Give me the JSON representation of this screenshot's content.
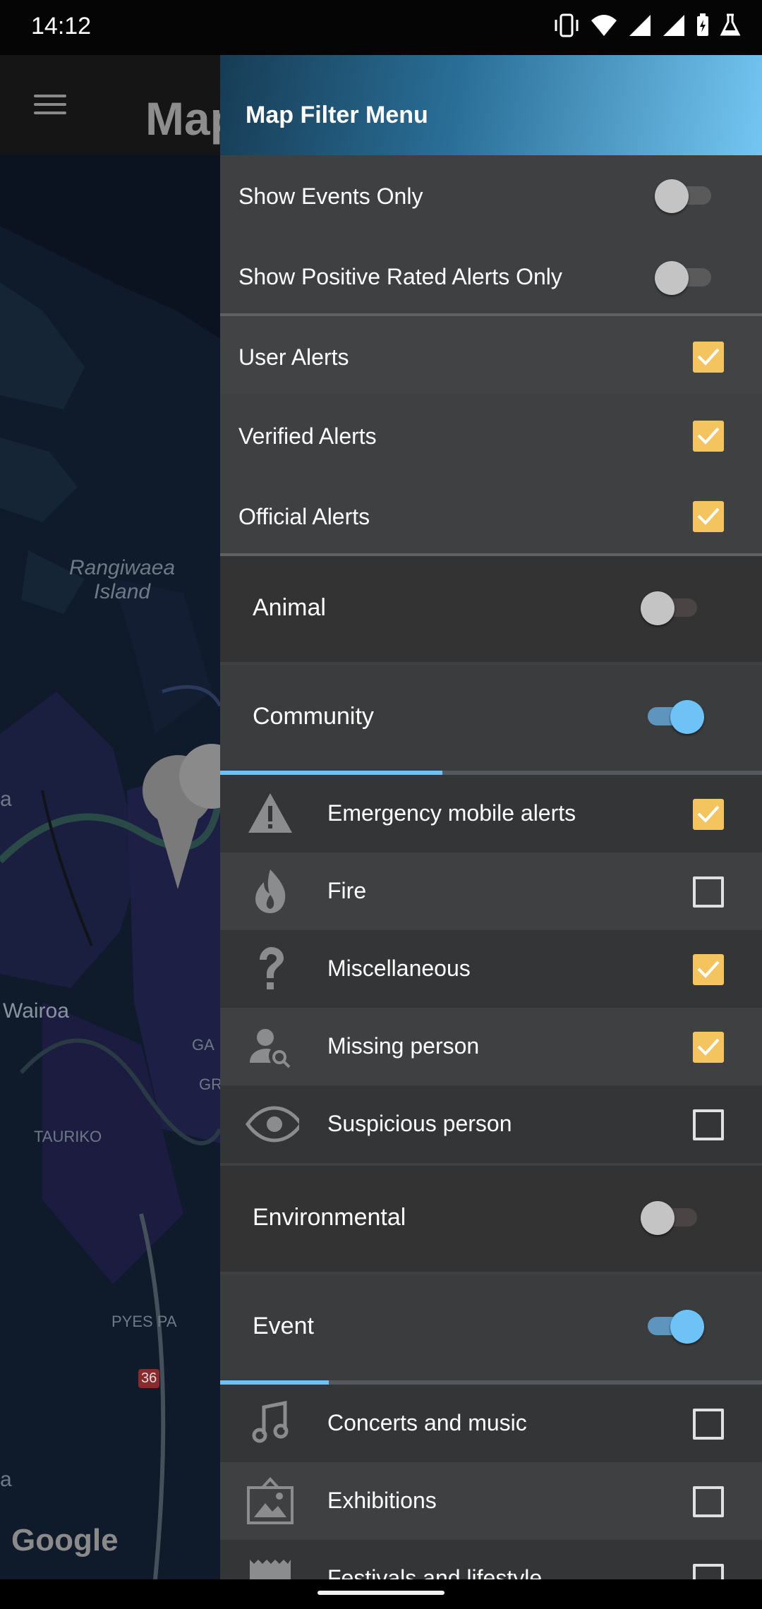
{
  "status_bar": {
    "time": "14:12"
  },
  "background_app": {
    "title": "Map",
    "map_labels": {
      "island": "Rangiwaea\nIsland",
      "wairoa": "Wairoa",
      "tauriko": "TAURIKO",
      "pyes_pa": "PYES PA",
      "route": "36",
      "edge_a1": "a",
      "edge_a2": "a",
      "ga": "GA",
      "gr": "GR"
    },
    "google_logo": "Google"
  },
  "drawer": {
    "title": "Map Filter Menu",
    "toggles": [
      {
        "label": "Show Events Only",
        "on": false
      },
      {
        "label": "Show Positive Rated Alerts Only",
        "on": false
      }
    ],
    "alert_types": [
      {
        "label": "User Alerts",
        "checked": true
      },
      {
        "label": "Verified Alerts",
        "checked": true
      },
      {
        "label": "Official Alerts",
        "checked": true
      }
    ],
    "categories": {
      "animal": {
        "label": "Animal",
        "on": false
      },
      "community": {
        "label": "Community",
        "on": true,
        "tab_progress": 0.41,
        "items": [
          {
            "label": "Emergency mobile alerts",
            "icon": "warning-icon",
            "checked": true
          },
          {
            "label": "Fire",
            "icon": "fire-icon",
            "checked": false
          },
          {
            "label": "Miscellaneous",
            "icon": "question-icon",
            "checked": true
          },
          {
            "label": "Missing person",
            "icon": "person-search-icon",
            "checked": true
          },
          {
            "label": "Suspicious person",
            "icon": "eye-icon",
            "checked": false
          }
        ]
      },
      "environmental": {
        "label": "Environmental",
        "on": false
      },
      "event": {
        "label": "Event",
        "on": true,
        "tab_progress": 0.2,
        "items": [
          {
            "label": "Concerts and music",
            "icon": "music-icon",
            "checked": false
          },
          {
            "label": "Exhibitions",
            "icon": "image-icon",
            "checked": false
          },
          {
            "label": "Festivals and lifestyle",
            "icon": "mask-icon",
            "checked": false
          }
        ]
      }
    },
    "colors": {
      "accent": "#6ec2f5",
      "checkbox": "#f4c45e",
      "background": "#3e4042"
    }
  }
}
